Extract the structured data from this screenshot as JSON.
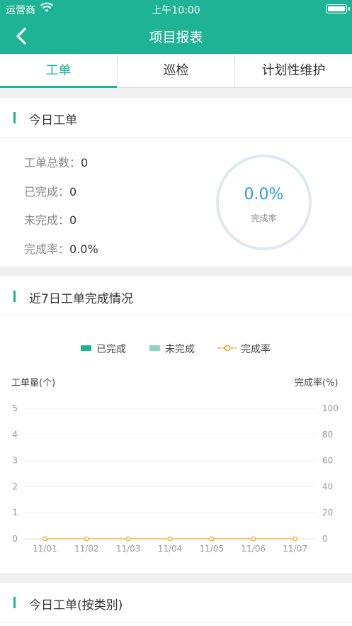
{
  "status_bar": {
    "carrier": "运营商",
    "time": "上午10:00"
  },
  "nav": {
    "title": "项目报表"
  },
  "tabs": [
    {
      "label": "工单",
      "active": true
    },
    {
      "label": "巡检",
      "active": false
    },
    {
      "label": "计划性维护",
      "active": false
    }
  ],
  "today": {
    "title": "今日工单",
    "total_label": "工单总数：",
    "total": "0",
    "done_label": "已完成：",
    "done": "0",
    "undone_label": "未完成：",
    "undone": "0",
    "rate_label": "完成率：",
    "rate": "0.0%",
    "ring_value": "0.0%",
    "ring_label": "完成率"
  },
  "week": {
    "title": "近7日工单完成情况",
    "legend": {
      "done": "已完成",
      "undone": "未完成",
      "rate": "完成率"
    },
    "left_axis_title": "工单量(个)",
    "right_axis_title": "完成率(%)"
  },
  "category": {
    "title": "今日工单(按类别)"
  },
  "colors": {
    "brand": "#1eb394",
    "undone": "#8fd3c5",
    "rate": "#f5a623",
    "ring_text": "#2a9fd6"
  },
  "chart_data": {
    "type": "bar",
    "categories": [
      "11/01",
      "11/02",
      "11/03",
      "11/04",
      "11/05",
      "11/06",
      "11/07"
    ],
    "series": [
      {
        "name": "已完成",
        "type": "bar",
        "values": [
          0,
          0,
          0,
          0,
          0,
          0,
          0
        ]
      },
      {
        "name": "未完成",
        "type": "bar",
        "values": [
          0,
          0,
          0,
          0,
          0,
          0,
          0
        ]
      },
      {
        "name": "完成率",
        "type": "line",
        "axis": "right",
        "values": [
          0,
          0,
          0,
          0,
          0,
          0,
          0
        ]
      }
    ],
    "ylabel": "工单量(个)",
    "ylabel_right": "完成率(%)",
    "ylim": [
      0,
      5
    ],
    "ylim_right": [
      0,
      100
    ],
    "yticks": [
      "0",
      "1",
      "2",
      "3",
      "4",
      "5"
    ],
    "yticks_right": [
      "0",
      "20",
      "40",
      "60",
      "80",
      "100"
    ],
    "grid": true,
    "legend_position": "top-center"
  }
}
